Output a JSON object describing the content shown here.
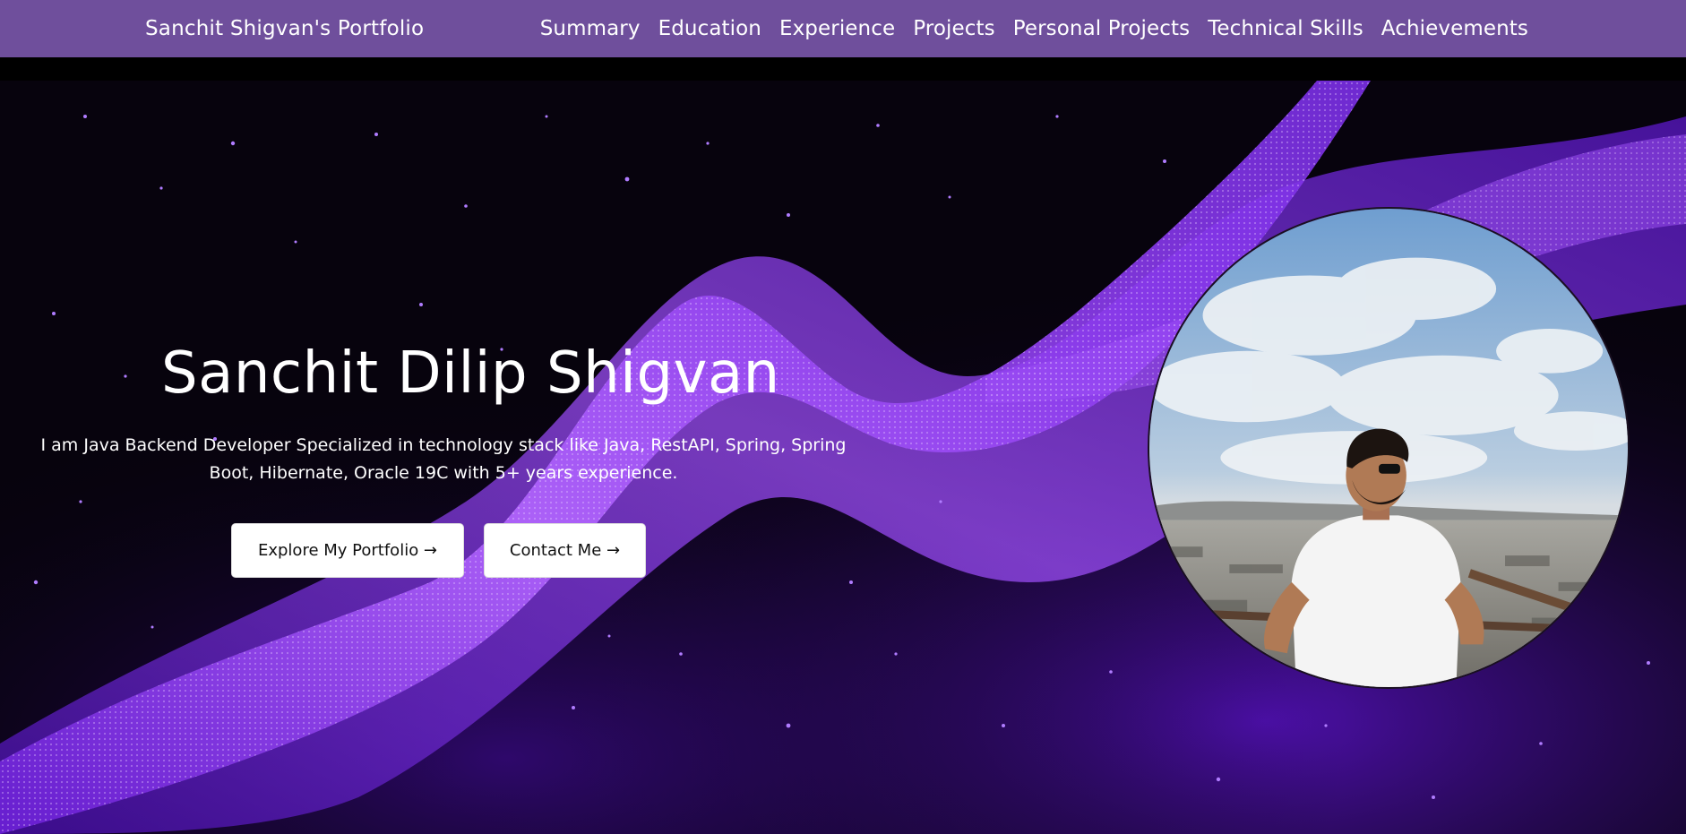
{
  "navbar": {
    "brand": "Sanchit Shigvan's Portfolio",
    "links": [
      "Summary",
      "Education",
      "Experience",
      "Projects",
      "Personal Projects",
      "Technical Skills",
      "Achievements"
    ]
  },
  "hero": {
    "name": "Sanchit Dilip Shigvan",
    "description": "I am Java Backend Developer Specialized in technology stack like Java, RestAPI, Spring, Spring Boot, Hibernate, Oracle 19C with 5+ years experience.",
    "buttons": {
      "explore": "Explore My Portfolio →",
      "contact": "Contact Me →"
    }
  },
  "colors": {
    "navbar": "#6f4f9c",
    "accent": "#8a2be2"
  }
}
